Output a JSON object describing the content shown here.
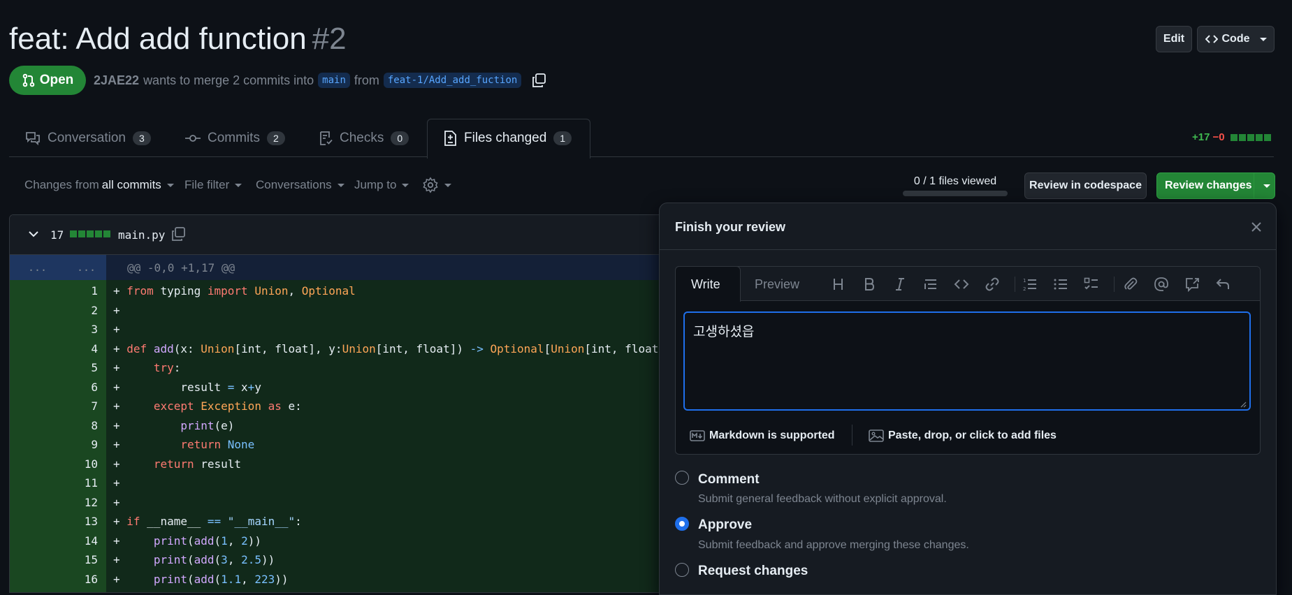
{
  "header": {
    "title": "feat: Add add function",
    "pr_number": "#2",
    "edit_label": "Edit",
    "code_label": "Code",
    "state": "Open",
    "author": "2JAE22",
    "meta_text": "wants to merge 2 commits into",
    "base_branch": "main",
    "from_text": "from",
    "head_branch": "feat-1/Add_add_fuction"
  },
  "tabs": [
    {
      "label": "Conversation",
      "count": "3"
    },
    {
      "label": "Commits",
      "count": "2"
    },
    {
      "label": "Checks",
      "count": "0"
    },
    {
      "label": "Files changed",
      "count": "1"
    }
  ],
  "diffstat": {
    "added": "+17",
    "removed": "−0"
  },
  "toolbar": {
    "changes_from": "Changes from",
    "all_commits": "all commits",
    "file_filter": "File filter",
    "conversations": "Conversations",
    "jump_to": "Jump to",
    "files_viewed": "0 / 1 files viewed",
    "review_codespace": "Review in codespace",
    "review_changes": "Review changes"
  },
  "file": {
    "changes": "17",
    "name": "main.py",
    "hunk_header": "@@ -0,0 +1,17 @@",
    "hunk_dots": "...",
    "lines": [
      {
        "n": "1",
        "text": "+ from typing import Union, Optional"
      },
      {
        "n": "2",
        "text": "+"
      },
      {
        "n": "3",
        "text": "+"
      },
      {
        "n": "4",
        "text": "+ def add(x: Union[int, float], y:Union[int, float]) -> Optional[Union[int, float]]:"
      },
      {
        "n": "5",
        "text": "+     try:"
      },
      {
        "n": "6",
        "text": "+         result = x+y"
      },
      {
        "n": "7",
        "text": "+     except Exception as e:"
      },
      {
        "n": "8",
        "text": "+         print(e)"
      },
      {
        "n": "9",
        "text": "+         return None"
      },
      {
        "n": "10",
        "text": "+     return result"
      },
      {
        "n": "11",
        "text": "+"
      },
      {
        "n": "12",
        "text": "+"
      },
      {
        "n": "13",
        "text": "+ if __name__ == \"__main__\":"
      },
      {
        "n": "14",
        "text": "+     print(add(1, 2))"
      },
      {
        "n": "15",
        "text": "+     print(add(3, 2.5))"
      },
      {
        "n": "16",
        "text": "+     print(add(1.1, 223))"
      }
    ]
  },
  "review": {
    "title": "Finish your review",
    "write_tab": "Write",
    "preview_tab": "Preview",
    "body": "고생하셨읍",
    "markdown_note": "Markdown is supported",
    "attach_note": "Paste, drop, or click to add files",
    "options": [
      {
        "label": "Comment",
        "desc": "Submit general feedback without explicit approval."
      },
      {
        "label": "Approve",
        "desc": "Submit feedback and approve merging these changes."
      },
      {
        "label": "Request changes",
        "desc": ""
      }
    ],
    "selected": "Approve"
  },
  "colors": {
    "accent": "#1f6feb",
    "success": "#238636",
    "danger": "#f85149",
    "added_bg": "#11291a"
  }
}
